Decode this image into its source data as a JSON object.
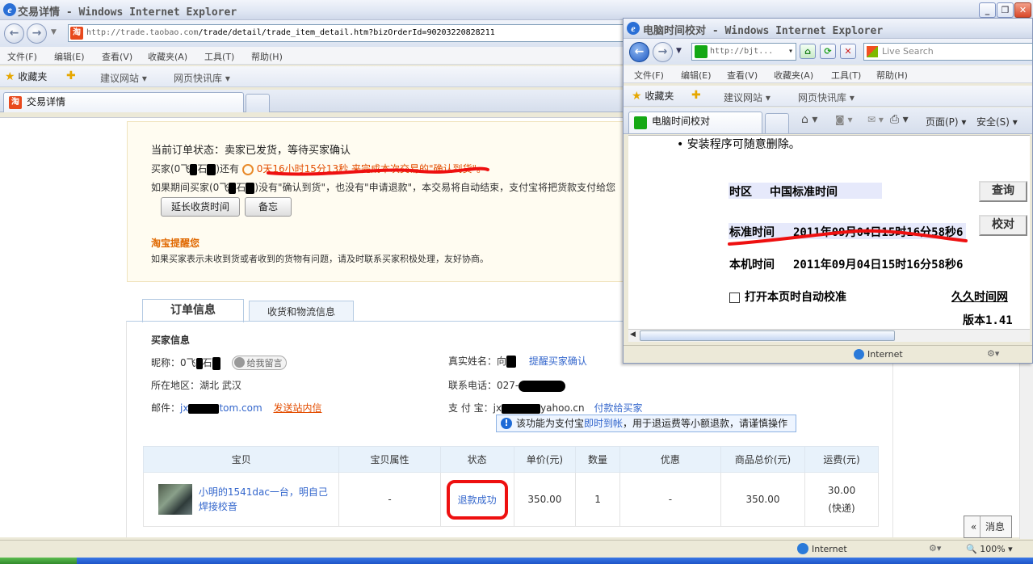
{
  "main_window": {
    "title": "交易详情 - Windows Internet Explorer",
    "url_host": "http://trade.taobao.com",
    "url_path": "/trade/detail/trade_item_detail.htm?bizOrderId=90203220828211",
    "menu": [
      "文件(F)",
      "编辑(E)",
      "查看(V)",
      "收藏夹(A)",
      "工具(T)",
      "帮助(H)"
    ],
    "favorites_label": "收藏夹",
    "suggested_sites": "建议网站",
    "web_slices": "网页快讯库",
    "tab_title": "交易详情",
    "status_zone": "Internet",
    "zoom": "100%"
  },
  "order_status": {
    "title": "当前订单状态：卖家已发货，等待买家确认",
    "buyer_prefix": "买家(0飞",
    "buyer_mid": "石",
    "still_has": ")还有",
    "countdown": "0天16小时15分13秒",
    "countdown_tail": "来完成本次交易的\"确认到货\"。",
    "line2_a": "如果期间买家(0飞",
    "line2_b": "石",
    "line2_c": ")没有\"确认到货\"，也没有\"申请退款\"，本交易将自动结束，支付宝将把货款支付给您",
    "btn_extend": "延长收货时间",
    "btn_memo": "备忘",
    "tip_title": "淘宝提醒您",
    "tip_text": "如果买家表示未收到货或者收到的货物有问题，请及时联系买家积极处理，友好协商。"
  },
  "tabs": [
    "订单信息",
    "收货和物流信息"
  ],
  "buyer_info": {
    "heading": "买家信息",
    "nick_label": "昵称：",
    "nick_a": "0飞",
    "nick_b": "石",
    "leave_message": "给我留言",
    "region_label": "所在地区：",
    "region": "湖北 武汉",
    "email_label": "邮件：",
    "email_a": "jx",
    "email_b": "tom.com",
    "send_msg": "发送站内信",
    "realname_label": "真实姓名：",
    "realname": "向",
    "remind": "提醒买家确认",
    "phone_label": "联系电话：",
    "phone": "027-",
    "alipay_label": "支 付 宝：",
    "alipay_a": "jx",
    "alipay_b": "yahoo.cn",
    "pay_buyer": "付款给买家",
    "notice_a": "该功能为支付宝",
    "notice_link": "即时到帐",
    "notice_b": "，用于退运费等小额退款，请谨慎操作"
  },
  "goods_table": {
    "headers": [
      "宝贝",
      "宝贝属性",
      "状态",
      "单价(元)",
      "数量",
      "优惠",
      "商品总价(元)",
      "运费(元)"
    ],
    "row": {
      "name": "小明的1541dac一台，明自己焊接校音",
      "attr": "-",
      "status": "退款成功",
      "price": "350.00",
      "qty": "1",
      "discount": "-",
      "total": "350.00",
      "shipping": "30.00",
      "shipping_method": "(快递)"
    }
  },
  "message_button": "消息",
  "popup": {
    "title": "电脑时间校对 - Windows Internet Explorer",
    "url": "http://bjt...",
    "search_placeholder": "Live Search",
    "menu": [
      "文件(F)",
      "编辑(E)",
      "查看(V)",
      "收藏夹(A)",
      "工具(T)",
      "帮助(H)"
    ],
    "favorites_label": "收藏夹",
    "suggested_sites": "建议网站",
    "web_slices": "网页快讯库",
    "tab_title": "电脑时间校对",
    "page_menu": "页面(P)",
    "safety_menu": "安全(S)",
    "note": "• 安装程序可随意删除。",
    "zone_label": "时区",
    "zone_value": "中国标准时间",
    "std_label": "标准时间",
    "std_value": "2011年09月04日15时16分58秒6",
    "local_label": "本机时间",
    "local_value": "2011年09月04日15时16分58秒6",
    "btn_query": "查询",
    "btn_calibrate": "校对",
    "auto_check": "打开本页时自动校准",
    "site_link": "久久时间网",
    "version": "版本1.41",
    "status_zone": "Internet"
  },
  "colors": {
    "accent_orange": "#e34d00",
    "link_blue": "#3366cc",
    "annotation_red": "#ee1010"
  }
}
